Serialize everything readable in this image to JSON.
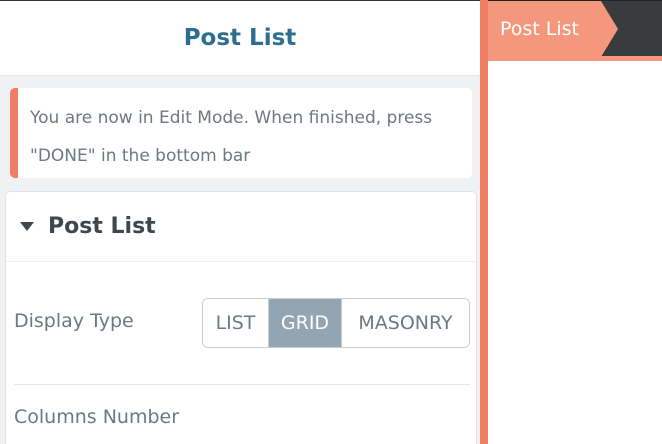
{
  "panel": {
    "title": "Post List",
    "notice": "You are now in Edit Mode. When finished, press \"DONE\" in the bottom bar"
  },
  "section": {
    "title": "Post List",
    "display_type": {
      "label": "Display Type",
      "options": [
        "LIST",
        "GRID",
        "MASONRY"
      ],
      "selected": "GRID"
    },
    "columns_number": {
      "label": "Columns Number"
    }
  },
  "preview": {
    "tab_label": "Post List"
  },
  "colors": {
    "accent": "#f07e62",
    "title": "#2c6e8f",
    "selected_segment": "#93a4b3"
  }
}
